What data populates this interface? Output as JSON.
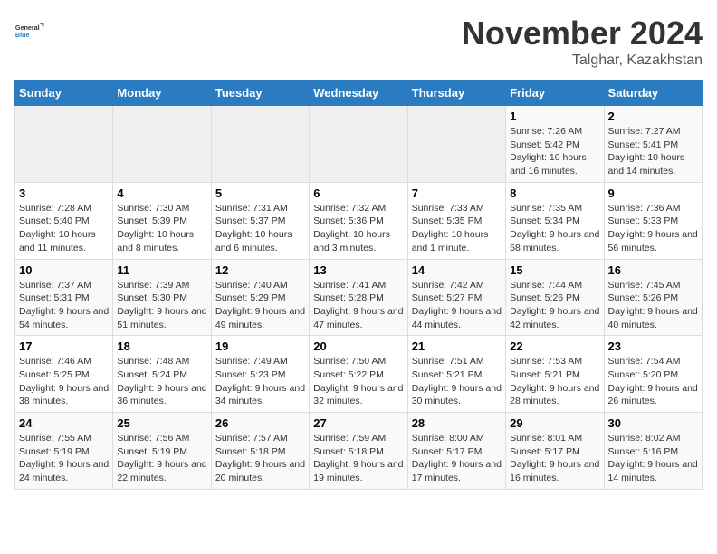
{
  "logo": {
    "line1": "General",
    "line2": "Blue"
  },
  "title": "November 2024",
  "location": "Talghar, Kazakhstan",
  "days_of_week": [
    "Sunday",
    "Monday",
    "Tuesday",
    "Wednesday",
    "Thursday",
    "Friday",
    "Saturday"
  ],
  "weeks": [
    [
      {
        "day": "",
        "info": ""
      },
      {
        "day": "",
        "info": ""
      },
      {
        "day": "",
        "info": ""
      },
      {
        "day": "",
        "info": ""
      },
      {
        "day": "",
        "info": ""
      },
      {
        "day": "1",
        "info": "Sunrise: 7:26 AM\nSunset: 5:42 PM\nDaylight: 10 hours and 16 minutes."
      },
      {
        "day": "2",
        "info": "Sunrise: 7:27 AM\nSunset: 5:41 PM\nDaylight: 10 hours and 14 minutes."
      }
    ],
    [
      {
        "day": "3",
        "info": "Sunrise: 7:28 AM\nSunset: 5:40 PM\nDaylight: 10 hours and 11 minutes."
      },
      {
        "day": "4",
        "info": "Sunrise: 7:30 AM\nSunset: 5:39 PM\nDaylight: 10 hours and 8 minutes."
      },
      {
        "day": "5",
        "info": "Sunrise: 7:31 AM\nSunset: 5:37 PM\nDaylight: 10 hours and 6 minutes."
      },
      {
        "day": "6",
        "info": "Sunrise: 7:32 AM\nSunset: 5:36 PM\nDaylight: 10 hours and 3 minutes."
      },
      {
        "day": "7",
        "info": "Sunrise: 7:33 AM\nSunset: 5:35 PM\nDaylight: 10 hours and 1 minute."
      },
      {
        "day": "8",
        "info": "Sunrise: 7:35 AM\nSunset: 5:34 PM\nDaylight: 9 hours and 58 minutes."
      },
      {
        "day": "9",
        "info": "Sunrise: 7:36 AM\nSunset: 5:33 PM\nDaylight: 9 hours and 56 minutes."
      }
    ],
    [
      {
        "day": "10",
        "info": "Sunrise: 7:37 AM\nSunset: 5:31 PM\nDaylight: 9 hours and 54 minutes."
      },
      {
        "day": "11",
        "info": "Sunrise: 7:39 AM\nSunset: 5:30 PM\nDaylight: 9 hours and 51 minutes."
      },
      {
        "day": "12",
        "info": "Sunrise: 7:40 AM\nSunset: 5:29 PM\nDaylight: 9 hours and 49 minutes."
      },
      {
        "day": "13",
        "info": "Sunrise: 7:41 AM\nSunset: 5:28 PM\nDaylight: 9 hours and 47 minutes."
      },
      {
        "day": "14",
        "info": "Sunrise: 7:42 AM\nSunset: 5:27 PM\nDaylight: 9 hours and 44 minutes."
      },
      {
        "day": "15",
        "info": "Sunrise: 7:44 AM\nSunset: 5:26 PM\nDaylight: 9 hours and 42 minutes."
      },
      {
        "day": "16",
        "info": "Sunrise: 7:45 AM\nSunset: 5:26 PM\nDaylight: 9 hours and 40 minutes."
      }
    ],
    [
      {
        "day": "17",
        "info": "Sunrise: 7:46 AM\nSunset: 5:25 PM\nDaylight: 9 hours and 38 minutes."
      },
      {
        "day": "18",
        "info": "Sunrise: 7:48 AM\nSunset: 5:24 PM\nDaylight: 9 hours and 36 minutes."
      },
      {
        "day": "19",
        "info": "Sunrise: 7:49 AM\nSunset: 5:23 PM\nDaylight: 9 hours and 34 minutes."
      },
      {
        "day": "20",
        "info": "Sunrise: 7:50 AM\nSunset: 5:22 PM\nDaylight: 9 hours and 32 minutes."
      },
      {
        "day": "21",
        "info": "Sunrise: 7:51 AM\nSunset: 5:21 PM\nDaylight: 9 hours and 30 minutes."
      },
      {
        "day": "22",
        "info": "Sunrise: 7:53 AM\nSunset: 5:21 PM\nDaylight: 9 hours and 28 minutes."
      },
      {
        "day": "23",
        "info": "Sunrise: 7:54 AM\nSunset: 5:20 PM\nDaylight: 9 hours and 26 minutes."
      }
    ],
    [
      {
        "day": "24",
        "info": "Sunrise: 7:55 AM\nSunset: 5:19 PM\nDaylight: 9 hours and 24 minutes."
      },
      {
        "day": "25",
        "info": "Sunrise: 7:56 AM\nSunset: 5:19 PM\nDaylight: 9 hours and 22 minutes."
      },
      {
        "day": "26",
        "info": "Sunrise: 7:57 AM\nSunset: 5:18 PM\nDaylight: 9 hours and 20 minutes."
      },
      {
        "day": "27",
        "info": "Sunrise: 7:59 AM\nSunset: 5:18 PM\nDaylight: 9 hours and 19 minutes."
      },
      {
        "day": "28",
        "info": "Sunrise: 8:00 AM\nSunset: 5:17 PM\nDaylight: 9 hours and 17 minutes."
      },
      {
        "day": "29",
        "info": "Sunrise: 8:01 AM\nSunset: 5:17 PM\nDaylight: 9 hours and 16 minutes."
      },
      {
        "day": "30",
        "info": "Sunrise: 8:02 AM\nSunset: 5:16 PM\nDaylight: 9 hours and 14 minutes."
      }
    ]
  ]
}
